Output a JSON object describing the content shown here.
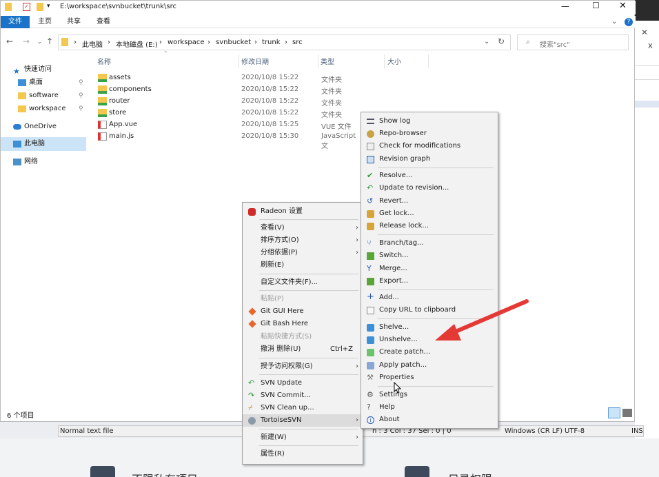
{
  "window": {
    "path_title": "E:\\workspace\\svnbucket\\trunk\\src",
    "ribbon_tabs": [
      "文件",
      "主页",
      "共享",
      "查看"
    ],
    "breadcrumbs": [
      "此电脑",
      "本地磁盘 (E:)",
      "workspace",
      "svnbucket",
      "trunk",
      "src"
    ],
    "search_placeholder": "搜索\"src\"",
    "status": "6 个项目"
  },
  "sidebar": {
    "items": [
      {
        "label": "快速访问",
        "icon": "star-icon"
      },
      {
        "label": "桌面",
        "icon": "desktop-folder-icon"
      },
      {
        "label": "software",
        "icon": "folder-icon"
      },
      {
        "label": "workspace",
        "icon": "folder-icon"
      },
      {
        "label": "OneDrive",
        "icon": "cloud-icon"
      },
      {
        "label": "此电脑",
        "icon": "computer-icon"
      },
      {
        "label": "网络",
        "icon": "network-icon"
      }
    ]
  },
  "table": {
    "columns": [
      "名称",
      "修改日期",
      "类型",
      "大小"
    ],
    "rows": [
      {
        "name": "assets",
        "date": "2020/10/8 15:22",
        "type": "文件夹"
      },
      {
        "name": "components",
        "date": "2020/10/8 15:22",
        "type": "文件夹"
      },
      {
        "name": "router",
        "date": "2020/10/8 15:22",
        "type": "文件夹"
      },
      {
        "name": "store",
        "date": "2020/10/8 15:22",
        "type": "文件夹"
      },
      {
        "name": "App.vue",
        "date": "2020/10/8 15:25",
        "type": "VUE 文件"
      },
      {
        "name": "main.js",
        "date": "2020/10/8 15:30",
        "type": "JavaScript 文"
      }
    ]
  },
  "context_menu": {
    "items": [
      {
        "label": "Radeon 设置"
      },
      {
        "label": "查看(V)"
      },
      {
        "label": "排序方式(O)"
      },
      {
        "label": "分组依据(P)"
      },
      {
        "label": "刷新(E)"
      },
      {
        "label": "自定义文件夹(F)..."
      },
      {
        "label": "粘贴(P)"
      },
      {
        "label": "Git GUI Here"
      },
      {
        "label": "Git Bash Here"
      },
      {
        "label": "粘贴快捷方式(S)"
      },
      {
        "label": "撤消 删除(U)",
        "shortcut": "Ctrl+Z"
      },
      {
        "label": "授予访问权限(G)"
      },
      {
        "label": "SVN Update"
      },
      {
        "label": "SVN Commit..."
      },
      {
        "label": "SVN Clean up..."
      },
      {
        "label": "TortoiseSVN"
      },
      {
        "label": "新建(W)"
      },
      {
        "label": "属性(R)"
      }
    ]
  },
  "svn_menu": {
    "items": [
      {
        "label": "Show log"
      },
      {
        "label": "Repo-browser"
      },
      {
        "label": "Check for modifications"
      },
      {
        "label": "Revision graph"
      },
      {
        "label": "Resolve..."
      },
      {
        "label": "Update to revision..."
      },
      {
        "label": "Revert..."
      },
      {
        "label": "Get lock..."
      },
      {
        "label": "Release lock..."
      },
      {
        "label": "Branch/tag..."
      },
      {
        "label": "Switch..."
      },
      {
        "label": "Merge..."
      },
      {
        "label": "Export..."
      },
      {
        "label": "Add..."
      },
      {
        "label": "Copy URL to clipboard"
      },
      {
        "label": "Shelve..."
      },
      {
        "label": "Unshelve..."
      },
      {
        "label": "Create patch..."
      },
      {
        "label": "Apply patch..."
      },
      {
        "label": "Properties"
      },
      {
        "label": "Settings"
      },
      {
        "label": "Help"
      },
      {
        "label": "About"
      }
    ]
  },
  "editor_status": {
    "file_type": "Normal text file",
    "position": "n : 3    Col : 37    Sel : 0 | 0",
    "eol": "Windows (CR LF)",
    "encoding": "UTF-8",
    "mode": "INS"
  },
  "background": {
    "close_glyph": "X",
    "left_label": "不限私有项目",
    "right_label": "目录权限"
  },
  "colors": {
    "accent": "#1a73c9",
    "arrow": "#e53935",
    "folder": "#f4c84e"
  }
}
